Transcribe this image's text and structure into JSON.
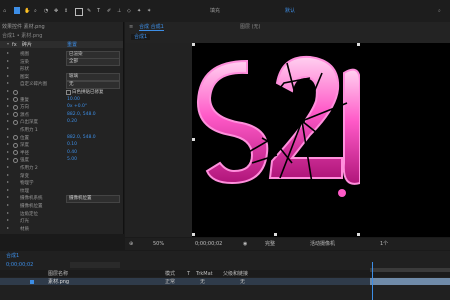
{
  "toolbar": {
    "title": "填充",
    "workspace": "默认",
    "tools": [
      "home-icon",
      "selection-tool",
      "hand-tool",
      "zoom-tool",
      "orbit-tool",
      "pan-tool",
      "dolly-tool",
      "rect-tool",
      "pen-tool",
      "text-tool",
      "brush-tool",
      "stamp-tool",
      "eraser-tool",
      "roto-tool",
      "puppet-tool"
    ]
  },
  "left_panel": {
    "tab": "效果控件 素材.png",
    "breadcrumb": "合成1 • 素材.png",
    "effect_name": "碎片",
    "reset": "重置",
    "rows": [
      {
        "label": "视图",
        "value": "已渲染",
        "type": "dropdown"
      },
      {
        "label": "渲染",
        "value": "全部",
        "type": "dropdown"
      },
      {
        "label": "形状",
        "value": "",
        "type": "group"
      },
      {
        "label": "图案",
        "value": "玻璃",
        "type": "dropdown"
      },
      {
        "label": "自定义碎片图",
        "value": "无",
        "type": "dropdown"
      },
      {
        "label": "",
        "value": "白色拼贴已修复",
        "type": "checkbox"
      },
      {
        "label": "重复",
        "value": "10.00",
        "type": "value"
      },
      {
        "label": "方向",
        "value": "0x +0.0°",
        "type": "value"
      },
      {
        "label": "源点",
        "value": "882.0, 548.0",
        "type": "value"
      },
      {
        "label": "凸出深度",
        "value": "0.20",
        "type": "value"
      },
      {
        "label": "作用力 1",
        "value": "",
        "type": "group"
      },
      {
        "label": "位置",
        "value": "882.0, 548.0",
        "type": "value"
      },
      {
        "label": "深度",
        "value": "0.10",
        "type": "value"
      },
      {
        "label": "半径",
        "value": "0.40",
        "type": "value"
      },
      {
        "label": "强度",
        "value": "5.00",
        "type": "value"
      },
      {
        "label": "作用力 2",
        "value": "",
        "type": "group"
      },
      {
        "label": "渐变",
        "value": "",
        "type": "group"
      },
      {
        "label": "物理学",
        "value": "",
        "type": "group"
      },
      {
        "label": "纹理",
        "value": "",
        "type": "group"
      },
      {
        "label": "摄像机系统",
        "value": "摄像机位置",
        "type": "dropdown"
      },
      {
        "label": "摄像机位置",
        "value": "",
        "type": "group"
      },
      {
        "label": "边角定位",
        "value": "",
        "type": "group"
      },
      {
        "label": "灯光",
        "value": "",
        "type": "group"
      },
      {
        "label": "材质",
        "value": "",
        "type": "group"
      }
    ]
  },
  "comp_panel": {
    "tabs": [
      "合成 合成1",
      "图层 (无)"
    ],
    "sub_tab": "合成1",
    "footer": {
      "zoom": "50%",
      "time": "0;00;00;02",
      "quality": "完整",
      "camera": "活动摄像机",
      "views": "1个"
    }
  },
  "viewer": {
    "text": "520",
    "accent": "#ff4fc3"
  },
  "timeline": {
    "tab": "合成1",
    "timecode": "0;00;00;02",
    "layer_name": "素材.png",
    "columns": [
      "图层名称",
      "模式",
      "T",
      "TrkMat",
      "父级和链接"
    ],
    "layer_mode": "正常",
    "layer_parent": "无",
    "layer_trk": "无"
  }
}
